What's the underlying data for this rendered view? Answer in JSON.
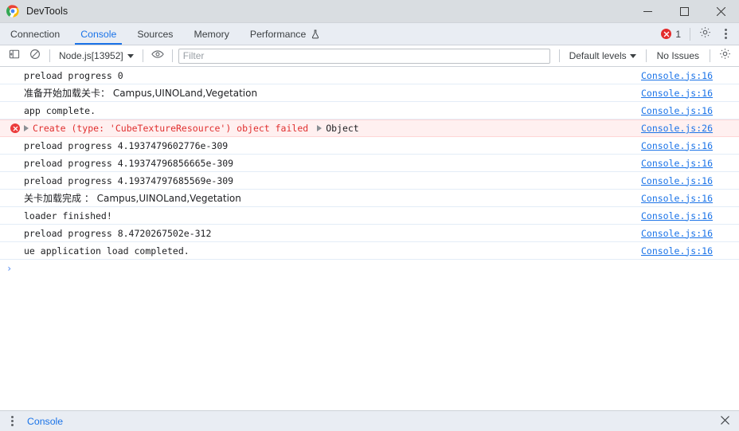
{
  "window": {
    "title": "DevTools",
    "logo_icon": "chrome-logo-icon",
    "minimize_label": "—",
    "maximize_label": "□",
    "close_label": "✕"
  },
  "tabstrip": {
    "tabs": [
      {
        "label": "Connection",
        "active": false,
        "icon": ""
      },
      {
        "label": "Console",
        "active": true,
        "icon": ""
      },
      {
        "label": "Sources",
        "active": false,
        "icon": ""
      },
      {
        "label": "Memory",
        "active": false,
        "icon": ""
      },
      {
        "label": "Performance",
        "active": false,
        "icon": "flask-icon"
      }
    ],
    "error_count": "1",
    "error_icon": "error-circle-icon",
    "settings_icon": "gear-icon",
    "more_icon": "more-vertical-icon"
  },
  "console_toolbar": {
    "sidebar_toggle_icon": "sidebar-panel-icon",
    "clear_icon": "clear-console-icon",
    "context_label": "Node.js[13952]",
    "context_caret_icon": "chevron-down-icon",
    "eye_icon": "live-expression-eye-icon",
    "filter_value": "",
    "filter_placeholder": "Filter",
    "levels_label": "Default levels",
    "levels_caret_icon": "chevron-down-icon",
    "issues_label": "No Issues",
    "settings_icon": "gear-icon"
  },
  "messages": [
    {
      "text": "preload progress 0",
      "level": "log",
      "cjk": false,
      "expandable": false,
      "extra": "",
      "source": "Console.js:16"
    },
    {
      "text": "准备开始加载关卡：  Campus,UINOLand,Vegetation",
      "level": "log",
      "cjk": true,
      "expandable": false,
      "extra": "",
      "source": "Console.js:16"
    },
    {
      "text": "app complete.",
      "level": "log",
      "cjk": false,
      "expandable": false,
      "extra": "",
      "source": "Console.js:16"
    },
    {
      "text": "Create (type: 'CubeTextureResource') object failed",
      "level": "error",
      "cjk": false,
      "expandable": true,
      "extra": "Object",
      "source": "Console.js:26"
    },
    {
      "text": "preload progress 4.1937479602776e-309",
      "level": "log",
      "cjk": false,
      "expandable": false,
      "extra": "",
      "source": "Console.js:16"
    },
    {
      "text": "preload progress 4.19374796856665e-309",
      "level": "log",
      "cjk": false,
      "expandable": false,
      "extra": "",
      "source": "Console.js:16"
    },
    {
      "text": "preload progress 4.19374797685569e-309",
      "level": "log",
      "cjk": false,
      "expandable": false,
      "extra": "",
      "source": "Console.js:16"
    },
    {
      "text": "关卡加载完成 ：  Campus,UINOLand,Vegetation",
      "level": "log",
      "cjk": true,
      "expandable": false,
      "extra": "",
      "source": "Console.js:16"
    },
    {
      "text": "loader finished!",
      "level": "log",
      "cjk": false,
      "expandable": false,
      "extra": "",
      "source": "Console.js:16"
    },
    {
      "text": "preload progress 8.4720267502e-312",
      "level": "log",
      "cjk": false,
      "expandable": false,
      "extra": "",
      "source": "Console.js:16"
    },
    {
      "text": "ue application load completed.",
      "level": "log",
      "cjk": false,
      "expandable": false,
      "extra": "",
      "source": "Console.js:16"
    }
  ],
  "prompt": {
    "chevron": "›"
  },
  "drawer": {
    "more_icon": "more-vertical-icon",
    "tab_label": "Console",
    "close_icon": "close-icon"
  },
  "colors": {
    "accent": "#1a73e8",
    "error": "#e02f2f",
    "error_bg": "#fff0f0",
    "toolbar_bg": "#e9edf3",
    "titlebar_bg": "#d9dde1"
  }
}
